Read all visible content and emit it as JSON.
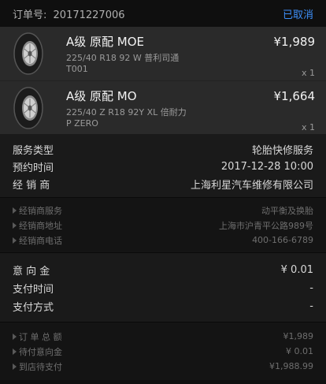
{
  "header": {
    "order_label": "订单号:",
    "order_no": "20171227006",
    "cancel_label": "已取消"
  },
  "products": [
    {
      "title": "A级 原配 MOE",
      "spec": "225/40 R18 92 W 普利司通",
      "code": "T001",
      "price": "¥1,989",
      "qty": "x 1"
    },
    {
      "title": "A级 原配 MO",
      "spec": "225/40 Z R18 92Y XL 倍耐力",
      "code": "P ZERO",
      "price": "¥1,664",
      "qty": "x 1"
    }
  ],
  "service": [
    {
      "label": "服务类型",
      "value": "轮胎快修服务"
    },
    {
      "label": "预约时间",
      "value": "2017-12-28 10:00"
    },
    {
      "label": "经 销 商",
      "value": "上海利星汽车维修有限公司"
    }
  ],
  "dealer": [
    {
      "label": "经销商服务",
      "value": "动平衡及换胎"
    },
    {
      "label": "经销商地址",
      "value": "上海市沪青平公路989号"
    },
    {
      "label": "经销商电话",
      "value": "400-166-6789"
    }
  ],
  "payment": [
    {
      "label": "意 向 金",
      "value": "¥ 0.01"
    },
    {
      "label": "支付时间",
      "value": "-"
    },
    {
      "label": "支付方式",
      "value": "-"
    }
  ],
  "totals": [
    {
      "label": "订 单 总 额",
      "value": "¥1,989"
    },
    {
      "label": "待付意向金",
      "value": "¥ 0.01"
    },
    {
      "label": "到店待支付",
      "value": "¥1,988.99"
    }
  ],
  "icons": {
    "tire": "tire-icon",
    "triangle": "triangle-right-icon"
  },
  "colors": {
    "accent": "#3d8ef7",
    "background": "#0f0f0f"
  }
}
